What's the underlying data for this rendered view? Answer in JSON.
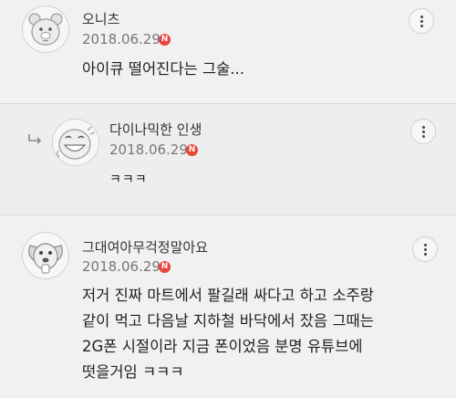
{
  "comments": [
    {
      "author": "오니츠",
      "date": "2018.06.29",
      "badge": "N",
      "text": "아이큐 떨어진다는 그술...",
      "avatar_icon": "bear-face-icon"
    },
    {
      "author": "다이나믹한 인생",
      "date": "2018.06.29",
      "badge": "N",
      "text": "ㅋㅋㅋ",
      "avatar_icon": "laughing-face-icon",
      "is_reply": true,
      "reply_icon": "reply-arrow-icon"
    },
    {
      "author": "그대여아무걱정말아요",
      "date": "2018.06.29",
      "badge": "N",
      "text_lines": [
        "저거 진짜 마트에서 팔길래 싸다고 하고 소주랑",
        "같이 먹고 다음날 지하철 바닥에서 잤음 그때는",
        "2G폰 시절이라 지금 폰이었음 분명 유튜브에",
        "떳을거임 ㅋㅋㅋ"
      ],
      "avatar_icon": "dog-face-icon"
    }
  ],
  "colors": {
    "badge": "#e8453c",
    "background": "#f1f1f1",
    "author": "#333333",
    "date": "#777777"
  },
  "more_icon": "more-vertical-icon"
}
